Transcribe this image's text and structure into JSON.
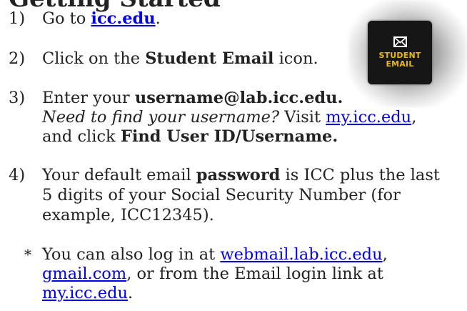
{
  "title_fragment": "Getting Started",
  "steps": [
    {
      "num": "1)",
      "pre": "Go to ",
      "link": "icc.edu",
      "post": "."
    },
    {
      "num": "2)",
      "pre": "Click on the ",
      "bold": "Student Email",
      "post": " icon."
    },
    {
      "num": "3)",
      "pre": "Enter your ",
      "bold": "username@lab.icc.edu.",
      "italic": "Need to find your username?",
      "mid": " Visit ",
      "link": "my.icc.edu",
      "mid2": ",",
      "line3_pre": "and click ",
      "line3_bold": "Find User ID/Username."
    },
    {
      "num": "4)",
      "pre": "Your default email ",
      "bold": "password",
      "post": " is ICC plus the last",
      "line2": "5 digits of your Social Security Number (for",
      "line3": "example, ICC12345)."
    }
  ],
  "note": {
    "marker": "*",
    "pre": "You can also log in at ",
    "link1": "webmail.lab.icc.edu",
    "sep1": ",",
    "link2": "gmail.com",
    "mid": ", or from the Email login link at",
    "link3": "my.icc.edu",
    "post": "."
  },
  "tile": {
    "icon": "envelope-icon",
    "line1": "STUDENT",
    "line2": "EMAIL",
    "bg": "#161616",
    "text_color": "#e9b90d"
  },
  "colors": {
    "link": "#0000ee",
    "text": "#222222"
  }
}
